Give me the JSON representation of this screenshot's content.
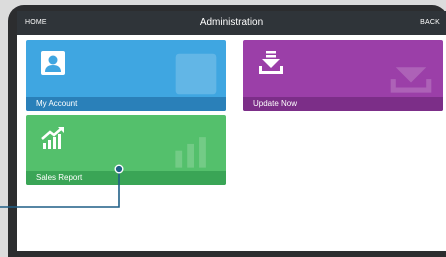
{
  "topbar": {
    "home_label": "HOME",
    "title": "Administration",
    "back_label": "BACK"
  },
  "tiles": [
    {
      "label": "My Account",
      "icon": "user-icon",
      "color": "#3fa6e1"
    },
    {
      "label": "Update Now",
      "icon": "download-tray-icon",
      "color": "#9b3fa8"
    },
    {
      "label": "Sales Report",
      "icon": "growth-chart-icon",
      "color": "#54c06c"
    }
  ],
  "callout": {
    "color": "#1f5f86"
  }
}
